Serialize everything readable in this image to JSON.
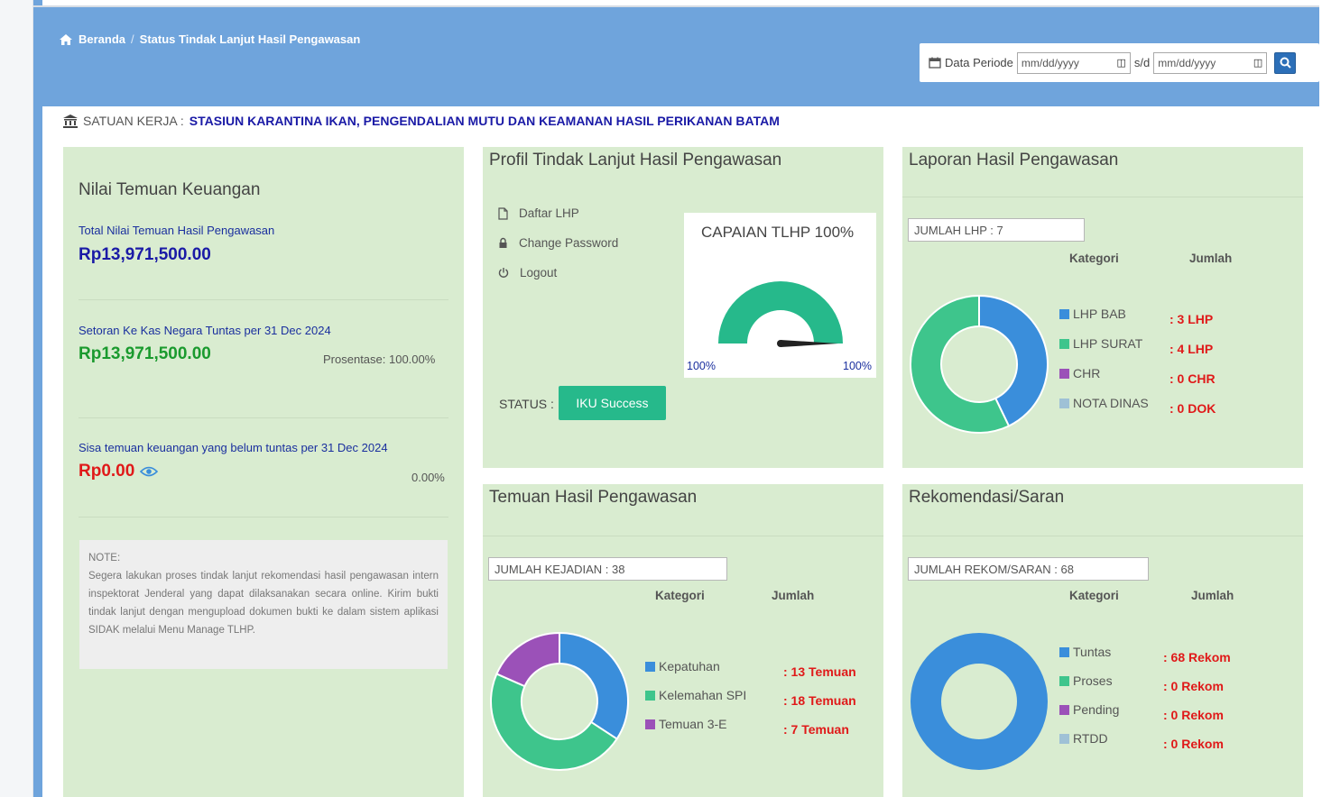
{
  "breadcrumb": {
    "home": "Beranda",
    "separator": "/",
    "current": "Status Tindak Lanjut Hasil Pengawasan"
  },
  "period": {
    "label": "Data Periode",
    "from_placeholder": "mm/dd/yyyy",
    "to_label": "s/d",
    "to_placeholder": "mm/dd/yyyy"
  },
  "satuan": {
    "label": "SATUAN KERJA :",
    "value": "STASIUN KARANTINA IKAN, PENGENDALIAN MUTU DAN KEAMANAN HASIL PERIKANAN BATAM"
  },
  "keuangan": {
    "title": "Nilai Temuan Keuangan",
    "total_label": "Total Nilai Temuan Hasil Pengawasan",
    "total_value": "Rp13,971,500.00",
    "setoran_label": "Setoran Ke Kas Negara Tuntas per 31 Dec 2024",
    "setoran_value": "Rp13,971,500.00",
    "setoran_pct": "Prosentase: 100.00%",
    "sisa_label": "Sisa temuan keuangan yang belum tuntas per 31 Dec 2024",
    "sisa_value": "Rp0.00",
    "sisa_pct": "0.00%",
    "note_title": "NOTE:",
    "note_text": "Segera lakukan proses tindak lanjut rekomendasi hasil pengawasan intern inspektorat Jenderal yang dapat dilaksanakan secara online. Kirim bukti tindak lanjut dengan mengupload dokumen bukti ke dalam sistem aplikasi SIDAK melalui Menu Manage TLHP."
  },
  "profil": {
    "title": "Profil Tindak Lanjut Hasil Pengawasan",
    "menu": [
      "Daftar LHP",
      "Change Password",
      "Logout"
    ],
    "gauge_title": "CAPAIAN TLHP 100%",
    "gauge_value_pct": 100,
    "gauge_min_label": "100%",
    "gauge_max_label": "100%",
    "status_label": "STATUS :",
    "status_button": "IKU Success"
  },
  "lhp": {
    "title": "Laporan Hasil Pengawasan",
    "total": "JUMLAH LHP : 7",
    "col_kategori": "Kategori",
    "col_jumlah": "Jumlah",
    "items": [
      {
        "label": "LHP BAB",
        "count": ": 3 LHP",
        "value": 3,
        "color": "#3a8edb"
      },
      {
        "label": "LHP SURAT",
        "count": ": 4 LHP",
        "value": 4,
        "color": "#3ec58c"
      },
      {
        "label": "CHR",
        "count": ": 0 CHR",
        "value": 0,
        "color": "#9b51b8"
      },
      {
        "label": "NOTA DINAS",
        "count": ": 0 DOK",
        "value": 0,
        "color": "#9fc1d6"
      }
    ]
  },
  "temuan": {
    "title": "Temuan Hasil Pengawasan",
    "total": "JUMLAH KEJADIAN : 38",
    "col_kategori": "Kategori",
    "col_jumlah": "Jumlah",
    "items": [
      {
        "label": "Kepatuhan",
        "count": ": 13 Temuan",
        "value": 13,
        "color": "#3a8edb"
      },
      {
        "label": "Kelemahan SPI",
        "count": ": 18 Temuan",
        "value": 18,
        "color": "#3ec58c"
      },
      {
        "label": "Temuan 3-E",
        "count": ": 7 Temuan",
        "value": 7,
        "color": "#9b51b8"
      }
    ]
  },
  "rekom": {
    "title": "Rekomendasi/Saran",
    "total": "JUMLAH REKOM/SARAN : 68",
    "col_kategori": "Kategori",
    "col_jumlah": "Jumlah",
    "items": [
      {
        "label": "Tuntas",
        "count": ": 68 Rekom",
        "value": 68,
        "color": "#3a8edb"
      },
      {
        "label": "Proses",
        "count": ": 0 Rekom",
        "value": 0,
        "color": "#3ec58c"
      },
      {
        "label": "Pending",
        "count": ": 0 Rekom",
        "value": 0,
        "color": "#9b51b8"
      },
      {
        "label": "RTDD",
        "count": ": 0 Rekom",
        "value": 0,
        "color": "#9fc1d6"
      }
    ]
  }
}
